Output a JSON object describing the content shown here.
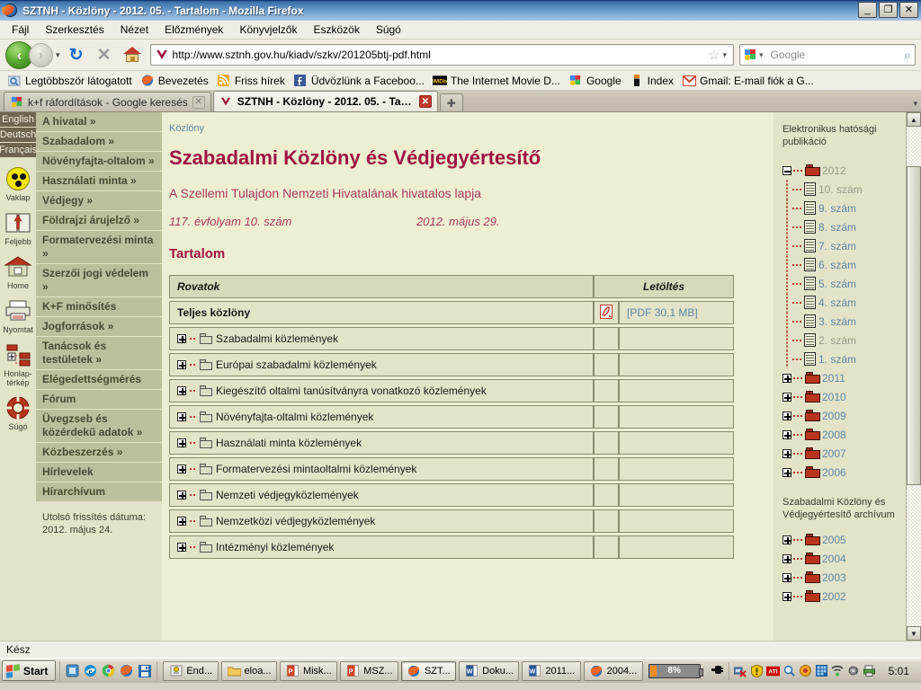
{
  "window": {
    "title": "SZTNH - Közlöny - 2012. 05. - Tartalom - Mozilla Firefox",
    "minimize_label": "_",
    "restore_label": "❐",
    "close_label": "✕"
  },
  "menubar": {
    "items": [
      {
        "label": "Fájl"
      },
      {
        "label": "Szerkesztés"
      },
      {
        "label": "Nézet"
      },
      {
        "label": "Előzmények"
      },
      {
        "label": "Könyvjelzők"
      },
      {
        "label": "Eszközök"
      },
      {
        "label": "Súgó"
      }
    ]
  },
  "navbar": {
    "back_label": "‹",
    "forward_label": "›",
    "history_caret": "▾",
    "reload_label": "↻",
    "stop_label": "✕",
    "url": "http://www.sztnh.gov.hu/kiadv/szkv/201205btj-pdf.html",
    "bookmark_star": "☆",
    "star_caret": "▾",
    "search_placeholder": "Google",
    "search_value": "",
    "search_caret": "▾",
    "magnifier": "⌕"
  },
  "bookmarks": {
    "items": [
      {
        "label": "Legtöbbször látogatott",
        "icon": "folder-search-icon"
      },
      {
        "label": "Bevezetés",
        "icon": "firefox-icon"
      },
      {
        "label": "Friss hírek",
        "icon": "rss-icon"
      },
      {
        "label": "Üdvözlünk a Faceboo...",
        "icon": "facebook-icon"
      },
      {
        "label": "The Internet Movie D...",
        "icon": "imdb-icon"
      },
      {
        "label": "Google",
        "icon": "google-icon"
      },
      {
        "label": "Index",
        "icon": "index-icon"
      },
      {
        "label": "Gmail: E-mail fiók a G...",
        "icon": "gmail-icon"
      }
    ]
  },
  "tabs": {
    "items": [
      {
        "label": "k+f ráfordítások - Google keresés",
        "active": false,
        "close": "✕"
      },
      {
        "label": "SZTNH - Közlöny - 2012. 05. - Tart...",
        "active": true,
        "close": "✕"
      }
    ],
    "new_tab_label": "✚",
    "list_all_label": "▾"
  },
  "page": {
    "lang_tabs": [
      {
        "label": "English"
      },
      {
        "label": "Deutsch"
      },
      {
        "label": "Français"
      }
    ],
    "rail_items": [
      {
        "label": "Vaklap",
        "icon": "blind-page-icon"
      },
      {
        "label": "Feljebb",
        "icon": "up-book-icon"
      },
      {
        "label": "Home",
        "icon": "home-icon"
      },
      {
        "label": "Nyomtat",
        "icon": "printer-icon"
      },
      {
        "label": "Honlap-térkép",
        "icon": "sitemap-icon"
      },
      {
        "label": "Súgó",
        "icon": "lifebuoy-help-icon"
      }
    ],
    "menu_items": [
      {
        "label": "A hivatal »"
      },
      {
        "label": "Szabadalom »"
      },
      {
        "label": "Növényfajta-oltalom »"
      },
      {
        "label": "Használati minta »"
      },
      {
        "label": "Védjegy »"
      },
      {
        "label": "Földrajzi árujelző »"
      },
      {
        "label": "Formatervezési minta »"
      },
      {
        "label": "Szerzői jogi védelem »"
      },
      {
        "label": "K+F minősítés"
      },
      {
        "label": "Jogforrások »"
      },
      {
        "label": "Tanácsok és testületek »"
      },
      {
        "label": "Elégedettségmérés"
      },
      {
        "label": "Fórum"
      },
      {
        "label": "Üvegzseb és közérdekű adatok »"
      },
      {
        "label": "Közbeszerzés »"
      },
      {
        "label": "Hírlevelek"
      },
      {
        "label": "Hírarchívum"
      }
    ],
    "last_update": "Utolsó frissítés dátuma: 2012. május 24.",
    "breadcrumb": "Közlöny",
    "title": "Szabadalmi Közlöny és Védjegyértesítő",
    "subtitle": "A Szellemi Tulajdon Nemzeti Hivatalának hivatalos lapja",
    "issue": "117. évfolyam 10. szám",
    "issue_date": "2012. május 29.",
    "contents_heading": "Tartalom",
    "table": {
      "columns": [
        "Rovatok",
        "Letöltés"
      ],
      "rows": [
        {
          "name": "Teljes közlöny",
          "bold": true,
          "expandable": false,
          "has_pdf": true,
          "download": "[PDF 30,1 MB]"
        },
        {
          "name": "Szabadalmi közlemények",
          "bold": false,
          "expandable": true,
          "has_pdf": false,
          "download": ""
        },
        {
          "name": "Európai szabadalmi közlemények",
          "bold": false,
          "expandable": true,
          "has_pdf": false,
          "download": ""
        },
        {
          "name": "Kiegészítő oltalmi tanúsítványra vonatkozó közlemények",
          "bold": false,
          "expandable": true,
          "has_pdf": false,
          "download": ""
        },
        {
          "name": "Növényfajta-oltalmi közlemények",
          "bold": false,
          "expandable": true,
          "has_pdf": false,
          "download": ""
        },
        {
          "name": "Használati minta közlemények",
          "bold": false,
          "expandable": true,
          "has_pdf": false,
          "download": ""
        },
        {
          "name": "Formatervezési mintaoltalmi közlemények",
          "bold": false,
          "expandable": true,
          "has_pdf": false,
          "download": ""
        },
        {
          "name": "Nemzeti védjegyközlemények",
          "bold": false,
          "expandable": true,
          "has_pdf": false,
          "download": ""
        },
        {
          "name": "Nemzetközi védjegyközlemények",
          "bold": false,
          "expandable": true,
          "has_pdf": false,
          "download": ""
        },
        {
          "name": "Intézményi közlemények",
          "bold": false,
          "expandable": true,
          "has_pdf": false,
          "download": ""
        }
      ]
    },
    "right": {
      "heading": "Elektronikus hatósági publikáció",
      "tree": [
        {
          "label": "2012",
          "type": "folder",
          "state": "expanded",
          "visited": true,
          "depth": 0
        },
        {
          "label": "10. szám",
          "type": "doc",
          "visited": true,
          "depth": 1
        },
        {
          "label": "9. szám",
          "type": "doc",
          "visited": false,
          "depth": 1
        },
        {
          "label": "8. szám",
          "type": "doc",
          "visited": false,
          "depth": 1
        },
        {
          "label": "7. szám",
          "type": "doc",
          "visited": false,
          "depth": 1
        },
        {
          "label": "6. szám",
          "type": "doc",
          "visited": false,
          "depth": 1
        },
        {
          "label": "5. szám",
          "type": "doc",
          "visited": false,
          "depth": 1
        },
        {
          "label": "4. szám",
          "type": "doc",
          "visited": false,
          "depth": 1
        },
        {
          "label": "3. szám",
          "type": "doc",
          "visited": false,
          "depth": 1
        },
        {
          "label": "2. szám",
          "type": "doc",
          "visited": true,
          "depth": 1
        },
        {
          "label": "1. szám",
          "type": "doc",
          "visited": false,
          "depth": 1
        },
        {
          "label": "2011",
          "type": "folder",
          "state": "collapsed",
          "visited": false,
          "depth": 0
        },
        {
          "label": "2010",
          "type": "folder",
          "state": "collapsed",
          "visited": false,
          "depth": 0
        },
        {
          "label": "2009",
          "type": "folder",
          "state": "collapsed",
          "visited": false,
          "depth": 0
        },
        {
          "label": "2008",
          "type": "folder",
          "state": "collapsed",
          "visited": false,
          "depth": 0
        },
        {
          "label": "2007",
          "type": "folder",
          "state": "collapsed",
          "visited": false,
          "depth": 0
        },
        {
          "label": "2006",
          "type": "folder",
          "state": "collapsed",
          "visited": false,
          "depth": 0
        }
      ],
      "archive_heading": "Szabadalmi Közlöny és Védjegyértesítő archívum",
      "archive_tree": [
        {
          "label": "2005",
          "type": "folder",
          "state": "collapsed",
          "visited": false,
          "depth": 0
        },
        {
          "label": "2004",
          "type": "folder",
          "state": "collapsed",
          "visited": false,
          "depth": 0
        },
        {
          "label": "2003",
          "type": "folder",
          "state": "collapsed",
          "visited": false,
          "depth": 0
        },
        {
          "label": "2002",
          "type": "folder",
          "state": "collapsed",
          "visited": false,
          "depth": 0
        }
      ]
    },
    "scrollbar": {
      "up": "▲",
      "down": "▼"
    }
  },
  "statusbar": {
    "text": "Kész"
  },
  "taskbar": {
    "start_label": "Start",
    "quicklaunch": [
      {
        "name": "show-desktop-icon",
        "glyph": "❐"
      },
      {
        "name": "internet-explorer-icon",
        "glyph": "e"
      },
      {
        "name": "chrome-icon",
        "glyph": "◉"
      },
      {
        "name": "firefox-icon",
        "glyph": "◕"
      },
      {
        "name": "save-disk-icon",
        "glyph": "■"
      }
    ],
    "tasks": [
      {
        "label": "End...",
        "icon": "endnote-icon",
        "active": false
      },
      {
        "label": "eloa...",
        "icon": "folder-icon",
        "active": false
      },
      {
        "label": "Misk...",
        "icon": "powerpoint-icon",
        "active": false
      },
      {
        "label": "MSZ...",
        "icon": "powerpoint-icon",
        "active": false
      },
      {
        "label": "SZT...",
        "icon": "firefox-icon",
        "active": true
      },
      {
        "label": "Doku...",
        "icon": "word-icon",
        "active": false
      },
      {
        "label": "2011...",
        "icon": "word-icon",
        "active": false
      },
      {
        "label": "2004...",
        "icon": "firefox-icon",
        "active": false
      }
    ],
    "battery_percent": "8%",
    "plug_icon": "⬛",
    "tray": [
      {
        "name": "network-error-icon",
        "glyph": "▣"
      },
      {
        "name": "warning-shield-icon",
        "glyph": "!"
      },
      {
        "name": "ati-icon",
        "glyph": "ATI"
      },
      {
        "name": "search-icon",
        "glyph": "⌕"
      },
      {
        "name": "media-icon",
        "glyph": "◉"
      },
      {
        "name": "grid-icon",
        "glyph": "▦"
      },
      {
        "name": "wifi-icon",
        "glyph": "◠"
      },
      {
        "name": "volume-icon",
        "glyph": "◔"
      },
      {
        "name": "printer-tray-icon",
        "glyph": "⎙"
      }
    ],
    "clock": "5:01"
  },
  "colors": {
    "page_bg": "#eeeed2",
    "sidebar_bg": "#e3e3c8",
    "menu_item_bg": "#bcbf9b",
    "heading": "#9e1540",
    "link": "#5c87a8",
    "lang_tab_bg": "#6e6550"
  }
}
